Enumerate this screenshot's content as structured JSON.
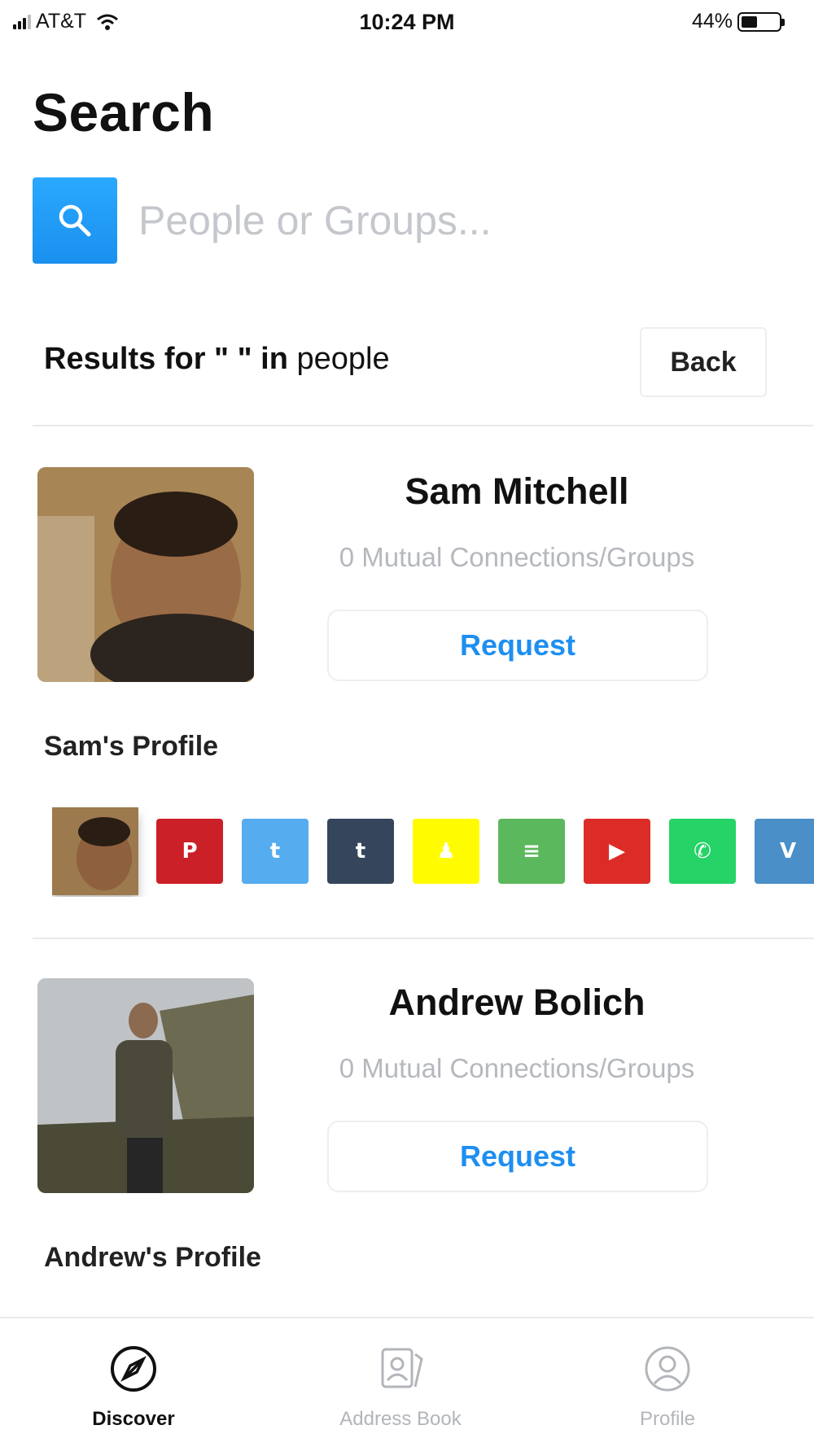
{
  "status_bar": {
    "carrier": "AT&T",
    "time": "10:24 PM",
    "battery": "44%",
    "battery_level": 0.44
  },
  "page": {
    "title": "Search"
  },
  "search": {
    "placeholder": "People or Groups...",
    "value": "",
    "icon": "search-icon",
    "accent_color": "#1f9bf5"
  },
  "results": {
    "prefix": "Results for \" \" in",
    "scope": " people",
    "back_label": "Back"
  },
  "people": [
    {
      "name": "Sam Mitchell",
      "mutual": "0 Mutual Connections/Groups",
      "request_label": "Request",
      "profile_label": "Sam's Profile",
      "avatar": "photo-sam"
    },
    {
      "name": "Andrew Bolich",
      "mutual": "0 Mutual Connections/Groups",
      "request_label": "Request",
      "profile_label": "Andrew's Profile",
      "avatar": "photo-andrew"
    }
  ],
  "social_links": [
    {
      "name": "pinterest",
      "glyph": "P",
      "color": "#cb2027"
    },
    {
      "name": "twitter",
      "glyph": "t",
      "color": "#55acee"
    },
    {
      "name": "tumblr",
      "glyph": "t",
      "color": "#35465c"
    },
    {
      "name": "snapchat",
      "glyph": "♟",
      "color": "#fffc00"
    },
    {
      "name": "messages",
      "glyph": "≡",
      "color": "#5cb85c"
    },
    {
      "name": "youtube",
      "glyph": "▶",
      "color": "#dd2c28"
    },
    {
      "name": "phone",
      "glyph": "✆",
      "color": "#25d366"
    },
    {
      "name": "vimeo",
      "glyph": "V",
      "color": "#4a8fc8"
    }
  ],
  "bottom_nav": {
    "items": [
      {
        "label": "Discover",
        "icon": "compass-icon",
        "active": true
      },
      {
        "label": "Address Book",
        "icon": "address-book-icon",
        "active": false
      },
      {
        "label": "Profile",
        "icon": "profile-icon",
        "active": false
      }
    ]
  }
}
